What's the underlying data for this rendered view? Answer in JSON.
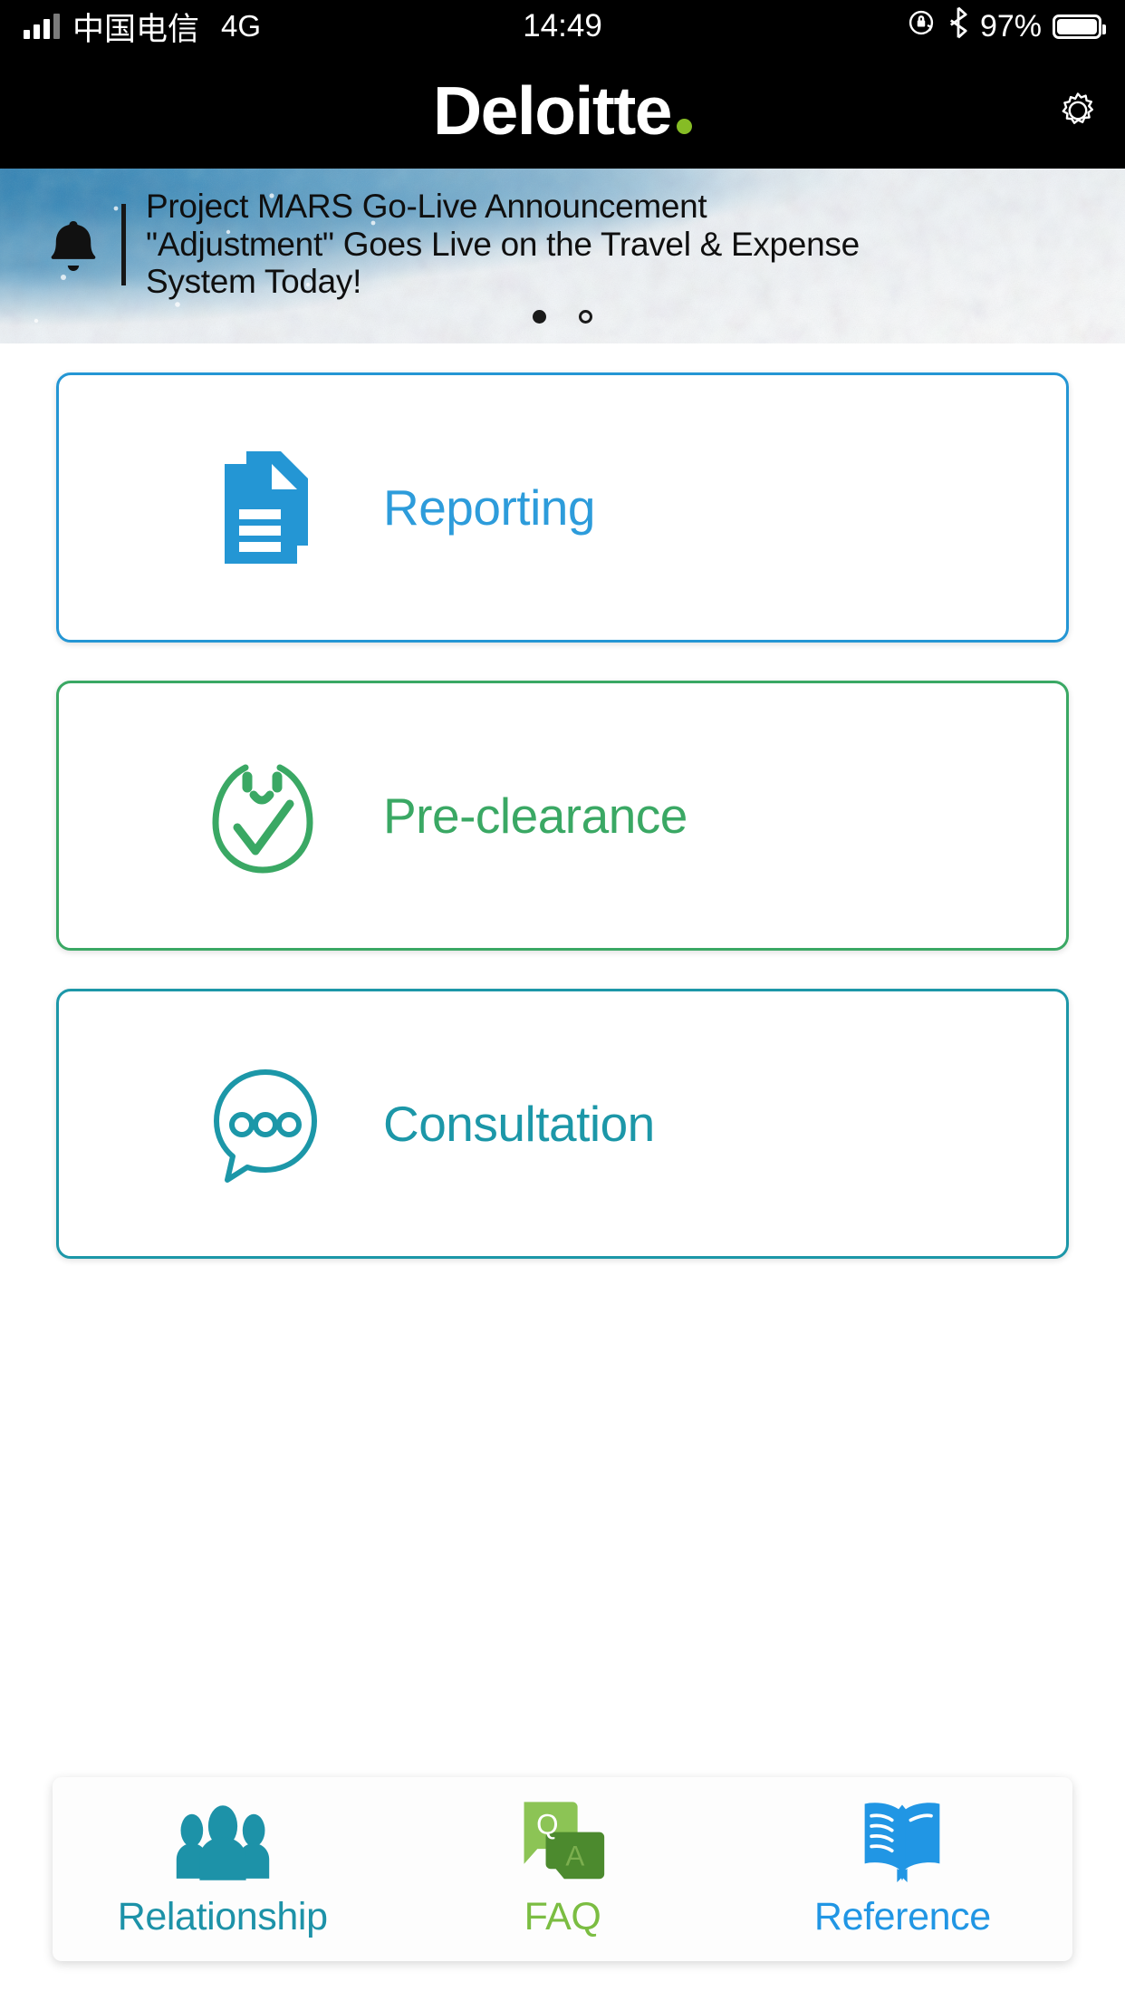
{
  "status_bar": {
    "carrier": "中国电信",
    "network": "4G",
    "time": "14:49",
    "battery_percent": "97%",
    "icons": [
      "signal-bars-icon",
      "rotation-lock-icon",
      "bluetooth-icon",
      "battery-icon"
    ]
  },
  "header": {
    "brand": "Deloitte",
    "brand_dot_color": "#86BC25",
    "settings_icon": "gear-icon"
  },
  "banner": {
    "bell_icon": "bell-icon",
    "announcement": "Project MARS Go-Live Announcement \"Adjustment\" Goes Live on the Travel & Expense System Today!",
    "line1": "Project MARS Go-Live Announcement",
    "line2": "\"Adjustment\" Goes Live on the Travel & Expense",
    "line3": "System Today!",
    "pagination": {
      "total": 2,
      "active_index": 0
    }
  },
  "main": {
    "cards": [
      {
        "label": "Reporting",
        "icon": "document-stack-icon",
        "color": "#2d9cdb",
        "border_color": "#2496d4"
      },
      {
        "label": "Pre-clearance",
        "icon": "check-circle-smiley-icon",
        "color": "#3aa864",
        "border_color": "#3aa864"
      },
      {
        "label": "Consultation",
        "icon": "speech-bubble-dots-icon",
        "color": "#1c97a8",
        "border_color": "#1c97a8"
      }
    ]
  },
  "bottom_nav": {
    "tabs": [
      {
        "label": "Relationship",
        "icon": "people-group-icon",
        "color": "#1d92a8"
      },
      {
        "label": "FAQ",
        "icon": "qa-bubbles-icon",
        "color": "#7bbd42"
      },
      {
        "label": "Reference",
        "icon": "open-book-icon",
        "color": "#2196e4"
      }
    ]
  }
}
